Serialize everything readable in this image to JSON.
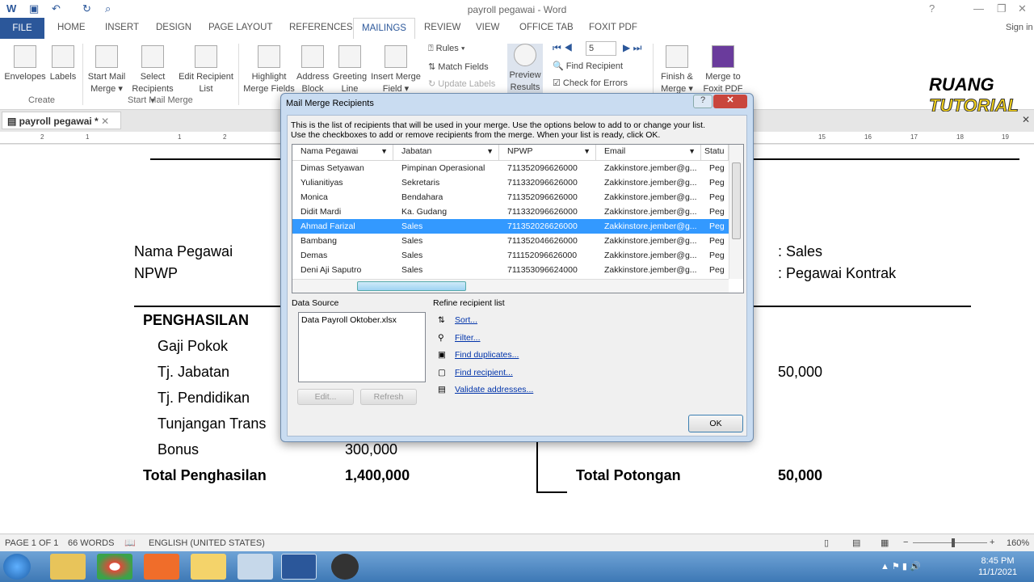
{
  "window": {
    "title": "payroll pegawai - Word",
    "sign_in": "Sign in"
  },
  "tabs": [
    "FILE",
    "HOME",
    "INSERT",
    "DESIGN",
    "PAGE LAYOUT",
    "REFERENCES",
    "MAILINGS",
    "REVIEW",
    "VIEW",
    "OFFICE TAB",
    "FOXIT PDF"
  ],
  "ribbon": {
    "create": {
      "envelopes": "Envelopes",
      "labels": "Labels",
      "group": "Create"
    },
    "start": {
      "start_mail_merge": "Start Mail Merge",
      "select_recipients": "Select Recipients",
      "edit_recipient_list": "Edit Recipient List",
      "group": "Start Mail Merge"
    },
    "write": {
      "highlight": "Highlight Merge Fields",
      "address_block": "Address Block",
      "greeting_line": "Greeting Line",
      "insert_merge_field": "Insert Merge Field",
      "rules": "Rules",
      "match_fields": "Match Fields",
      "update_labels": "Update Labels"
    },
    "preview": {
      "preview_results": "Preview Results",
      "record": "5",
      "find_recipient": "Find Recipient",
      "check_errors": "Check for Errors"
    },
    "finish": {
      "finish_merge": "Finish & Merge",
      "merge_foxit": "Merge to Foxit PDF"
    }
  },
  "doc_tab": {
    "name": "payroll pegawai *"
  },
  "ruler": [
    "2",
    "1",
    "1",
    "2",
    "15",
    "16",
    "17",
    "18",
    "19"
  ],
  "document": {
    "nama_label": "Nama Pegawai",
    "npwp_label": "NPWP",
    "jabatan_value": ": Sales",
    "status_value": ": Pegawai Kontrak",
    "penghasilan": "PENGHASILAN",
    "gaji": "Gaji Pokok",
    "tj_jabatan": "Tj. Jabatan",
    "tj_pendidikan": "Tj. Pendidikan",
    "tunjangan_trans": "Tunjangan Trans",
    "bonus": "Bonus",
    "bonus_value": "300,000",
    "potongan_value": "50,000",
    "total_penghasilan": "Total Penghasilan",
    "total_penghasilan_value": "1,400,000",
    "total_potongan": "Total Potongan",
    "total_potongan_value": "50,000"
  },
  "dialog": {
    "title": "Mail Merge Recipients",
    "intro1": "This is the list of recipients that will be used in your merge.  Use the options below to add to or change your list.",
    "intro2": "Use the checkboxes to add or remove recipients from the merge.  When your list is ready, click OK.",
    "columns": [
      "Nama Pegawai",
      "Jabatan",
      "NPWP",
      "Email",
      "Statu"
    ],
    "rows": [
      [
        "Dimas Setyawan",
        "Pimpinan Operasional",
        "711352096626000",
        "Zakkinstore.jember@g...",
        "Peg"
      ],
      [
        "Yulianitiyas",
        "Sekretaris",
        "711332096626000",
        "Zakkinstore.jember@g...",
        "Peg"
      ],
      [
        "Monica",
        "Bendahara",
        "711352096626000",
        "Zakkinstore.jember@g...",
        "Peg"
      ],
      [
        "Didit Mardi",
        "Ka. Gudang",
        "711332096626000",
        "Zakkinstore.jember@g...",
        "Peg"
      ],
      [
        "Ahmad Farizal",
        "Sales",
        "711352026626000",
        "Zakkinstore.jember@g...",
        "Peg"
      ],
      [
        "Bambang",
        "Sales",
        "711352046626000",
        "Zakkinstore.jember@g...",
        "Peg"
      ],
      [
        "Demas",
        "Sales",
        "711152096626000",
        "Zakkinstore.jember@g...",
        "Peg"
      ],
      [
        "Deni Aji Saputro",
        "Sales",
        "711353096624000",
        "Zakkinstore.jember@g...",
        "Peg"
      ]
    ],
    "selected_row": 4,
    "data_source_label": "Data Source",
    "data_source_item": "Data Payroll Oktober.xlsx",
    "refine_label": "Refine recipient list",
    "refine": [
      "Sort...",
      "Filter...",
      "Find duplicates...",
      "Find recipient...",
      "Validate addresses..."
    ],
    "edit": "Edit...",
    "refresh": "Refresh",
    "ok": "OK"
  },
  "status": {
    "page": "PAGE 1 OF 1",
    "words": "66 WORDS",
    "language": "ENGLISH (UNITED STATES)",
    "zoom": "160%"
  },
  "taskbar": {
    "time": "8:45 PM",
    "date": "11/1/2021"
  },
  "watermark": "RUANG TUTORIAL"
}
